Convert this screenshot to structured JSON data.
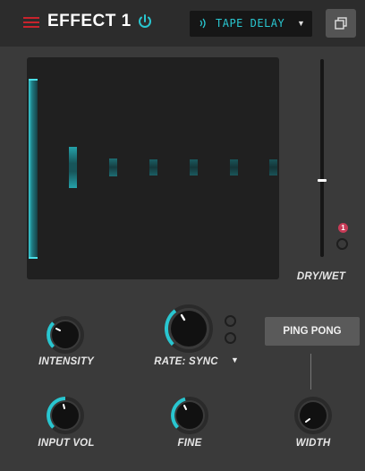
{
  "header": {
    "title": "EFFECT 1",
    "preset_name": "TAPE DELAY",
    "colors": {
      "brand_red": "#c8232c",
      "accent_cyan": "#29c6d0"
    }
  },
  "display": {
    "dry_wet_label": "DRY/WET",
    "sync_badge": "1"
  },
  "controls": {
    "intensity_label": "INTENSITY",
    "rate_label": "RATE: SYNC",
    "ping_pong_label": "PING PONG",
    "input_vol_label": "INPUT VOL",
    "fine_label": "FINE",
    "width_label": "WIDTH"
  },
  "icons": [
    "menu-icon",
    "power-icon",
    "wave-icon",
    "dropdown-arrow-icon",
    "copy-icon"
  ]
}
